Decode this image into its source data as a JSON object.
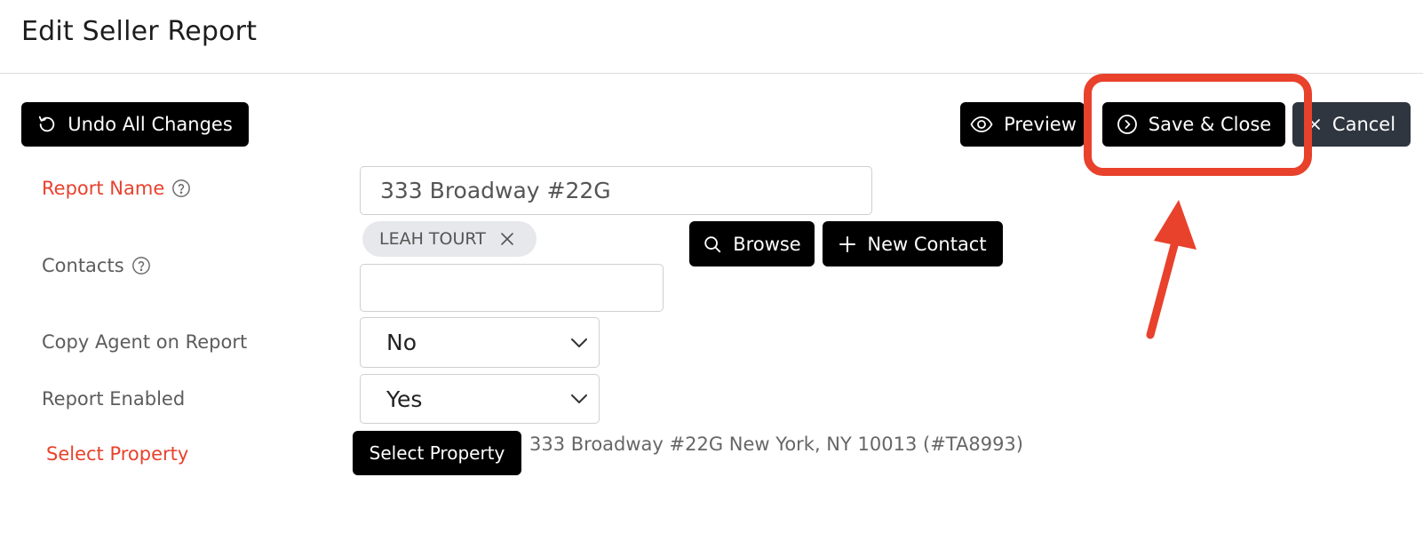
{
  "header": {
    "title": "Edit Seller Report"
  },
  "toolbar": {
    "undo_label": "Undo All Changes",
    "preview_label": "Preview",
    "save_label": "Save & Close",
    "cancel_label": "Cancel"
  },
  "form": {
    "report_name": {
      "label": "Report Name",
      "value": "333 Broadway #22G"
    },
    "contacts": {
      "label": "Contacts",
      "tags": [
        "LEAH TOURT"
      ],
      "input_value": "",
      "browse_label": "Browse",
      "new_contact_label": "New Contact"
    },
    "copy_agent": {
      "label": "Copy Agent on Report",
      "selected": "No"
    },
    "report_enabled": {
      "label": "Report Enabled",
      "selected": "Yes"
    },
    "select_property": {
      "label": "Select Property",
      "button_label": "Select Property",
      "value": "333 Broadway #22G New York, NY 10013 (#TA8993)"
    }
  },
  "colors": {
    "required_label": "#e8412c",
    "button_bg": "#000000",
    "cancel_bg": "#2f3640",
    "annotation": "#e8412c",
    "tag_bg": "#e6e8eb"
  },
  "icons": {
    "undo": "undo-icon",
    "preview": "eye-icon",
    "save": "chevron-right-circle-icon",
    "cancel": "close-icon",
    "help": "question-circle-icon",
    "browse": "search-icon",
    "new_contact": "plus-icon",
    "select": "chevron-down-icon"
  }
}
